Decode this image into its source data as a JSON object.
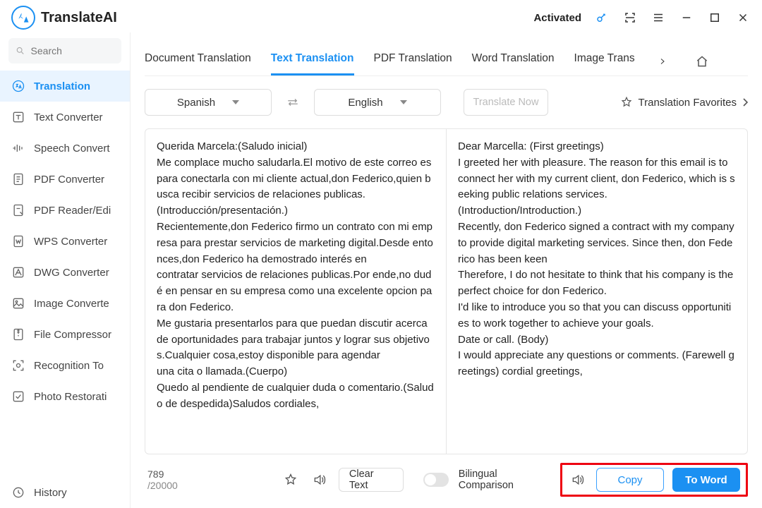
{
  "app_name": "TranslateAI",
  "activated_label": "Activated",
  "search": {
    "placeholder": "Search"
  },
  "sidebar": {
    "items": [
      {
        "label": "Translation"
      },
      {
        "label": "Text Converter"
      },
      {
        "label": "Speech Convert"
      },
      {
        "label": "PDF Converter"
      },
      {
        "label": "PDF Reader/Edi"
      },
      {
        "label": "WPS Converter"
      },
      {
        "label": "DWG Converter"
      },
      {
        "label": "Image Converte"
      },
      {
        "label": "File Compressor"
      },
      {
        "label": "Recognition To"
      },
      {
        "label": "Photo Restorati"
      },
      {
        "label": "History"
      }
    ]
  },
  "tabs": [
    {
      "label": "Document Translation"
    },
    {
      "label": "Text Translation"
    },
    {
      "label": "PDF Translation"
    },
    {
      "label": "Word Translation"
    },
    {
      "label": "Image Trans"
    }
  ],
  "lang": {
    "from": "Spanish",
    "to": "English"
  },
  "translate_btn": "Translate Now",
  "favorites_label": "Translation Favorites",
  "source_text": "Querida Marcela:(Saludo inicial)\nMe complace mucho saludarla.El motivo de este correo es para conectarla con mi cliente actual,don Federico,quien busca recibir servicios de relaciones publicas.\n(Introducción/presentación.)\nRecientemente,don Federico firmo un contrato con mi empresa para prestar servicios de marketing digital.Desde entonces,don Federico ha demostrado interés en\ncontratar servicios de relaciones publicas.Por ende,no dudé en pensar en su empresa como una excelente opcion para don Federico.\nMe gustaria presentarlos para que puedan discutir acerca de oportunidades para trabajar juntos y lograr sus objetivos.Cualquier cosa,estoy disponible para agendar\nuna cita o llamada.(Cuerpo)\nQuedo al pendiente de cualquier duda o comentario.(Saludo de despedida)Saludos cordiales,",
  "target_text": "Dear Marcella: (First greetings)\nI greeted her with pleasure. The reason for this email is to connect her with my current client, don Federico, which is seeking public relations services.\n(Introduction/Introduction.)\nRecently, don Federico signed a contract with my company to provide digital marketing services. Since then, don Federico has been keen\nTherefore, I do not hesitate to think that his company is the perfect choice for don Federico.\nI'd like to introduce you so that you can discuss opportunities to work together to achieve your goals.\nDate or call. (Body)\nI would appreciate any questions or comments. (Farewell greetings) cordial greetings,",
  "counter": {
    "current": "789",
    "max": "20000"
  },
  "clear_label": "Clear Text",
  "bilingual_label": "Bilingual Comparison",
  "copy_label": "Copy",
  "toword_label": "To Word"
}
